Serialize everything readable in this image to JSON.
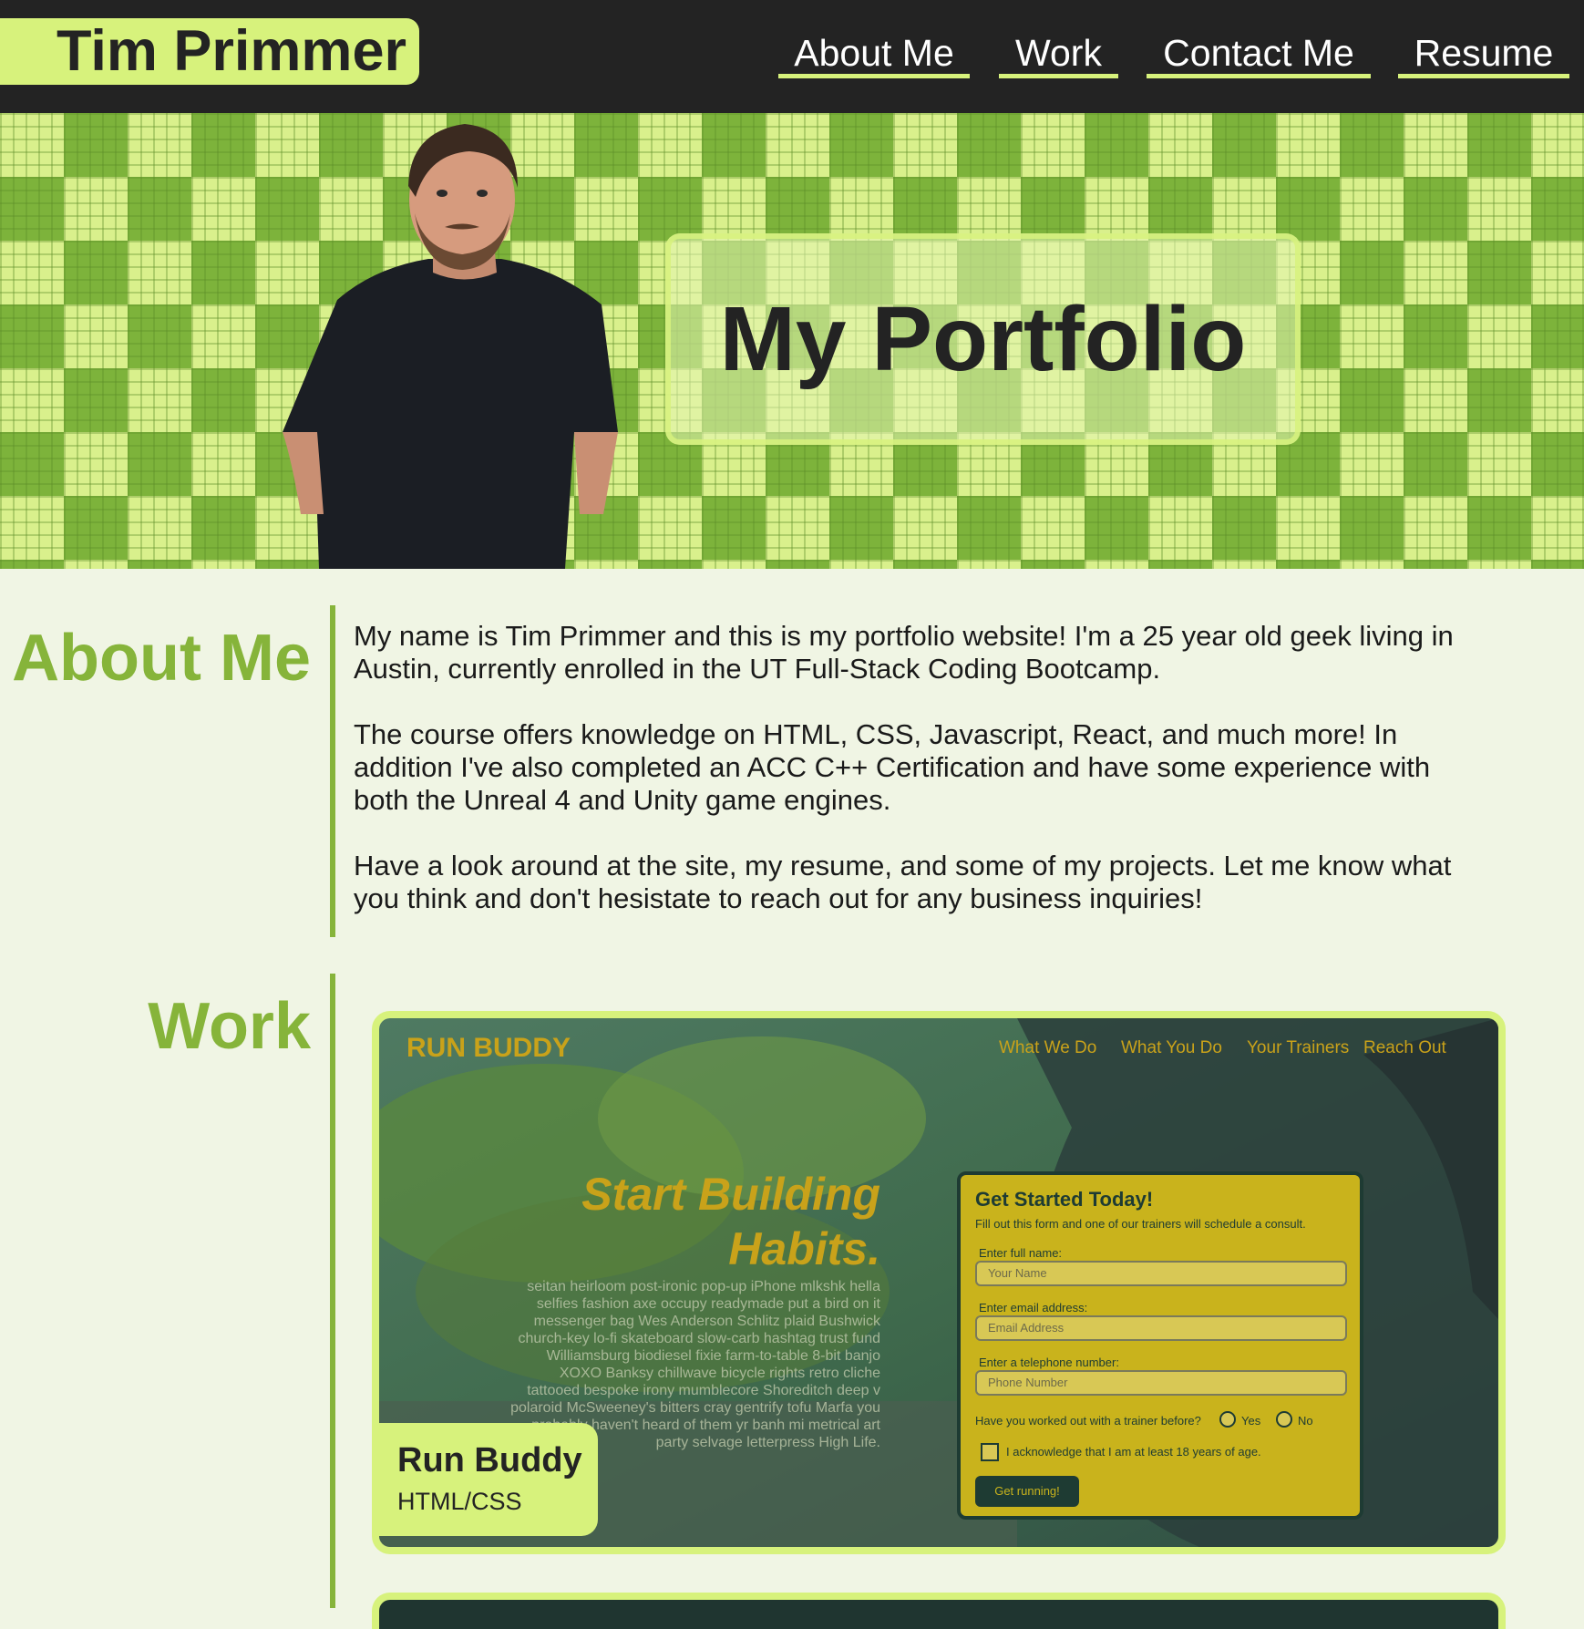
{
  "header": {
    "brand": "Tim Primmer",
    "nav": [
      "About Me",
      "Work",
      "Contact Me",
      "Resume"
    ]
  },
  "hero": {
    "title": "My Portfolio"
  },
  "about": {
    "heading": "About Me",
    "paragraphs": [
      "My name is Tim Primmer and this is my portfolio website! I'm a 25 year old geek living in Austin, currently enrolled in the UT Full-Stack Coding Bootcamp.",
      "The course offers knowledge on HTML, CSS, Javascript, React, and much more! In addition I've also completed an ACC C++ Certification and have some experience with both the Unreal 4 and Unity game engines.",
      "Have a look around at the site, my resume, and some of my projects. Let me know what you think and don't hesistate to reach out for any business inquiries!"
    ]
  },
  "work": {
    "heading": "Work",
    "projects": [
      {
        "name": "Run Buddy",
        "tech": "HTML/CSS",
        "screenshot": {
          "logo": "RUN BUDDY",
          "nav": [
            "What We Do",
            "What You Do",
            "Your Trainers",
            "Reach Out"
          ],
          "hero_line1": "Start Building",
          "hero_line2": "Habits.",
          "lorem": "seitan heirloom post-ironic pop-up iPhone mlkshk hella selfies fashion axe occupy readymade put a bird on it messenger bag Wes Anderson Schlitz plaid Bushwick church-key lo-fi skateboard slow-carb hashtag trust fund Williamsburg biodiesel fixie farm-to-table 8-bit banjo XOXO Banksy chillwave bicycle rights retro cliche tattooed bespoke irony mumblecore Shoreditch deep v polaroid McSweeney's bitters cray gentrify tofu Marfa you probably haven't heard of them yr banh mi metrical art party selvage letterpress High Life.",
          "form_title": "Get Started Today!",
          "form_subtitle": "Fill out this form and one of our trainers will schedule a consult.",
          "label_name": "Enter full name:",
          "placeholder_name": "Your Name",
          "label_email": "Enter email address:",
          "placeholder_email": "Email Address",
          "label_phone": "Enter a telephone number:",
          "placeholder_phone": "Phone Number",
          "question": "Have you worked out with a trainer before?",
          "yes": "Yes",
          "no": "No",
          "acknowledge": "I acknowledge that I am at least 18 years of age.",
          "button": "Get running!"
        }
      }
    ]
  },
  "colors": {
    "accent": "#d7f27c",
    "green": "#86b43a",
    "dark": "#232323",
    "background": "#f0f5e4"
  }
}
